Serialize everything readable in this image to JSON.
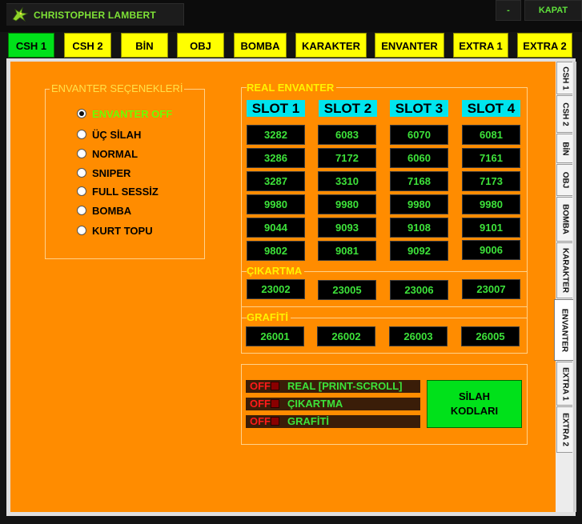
{
  "window": {
    "title": "CHRISTOPHER LAMBERT",
    "minimize_label": "-",
    "close_label": "KAPAT"
  },
  "tabs": [
    {
      "label": "CSH 1",
      "active": true
    },
    {
      "label": "CSH 2",
      "active": false
    },
    {
      "label": "BİN",
      "active": false
    },
    {
      "label": "OBJ",
      "active": false
    },
    {
      "label": "BOMBA",
      "active": false
    },
    {
      "label": "KARAKTER",
      "active": false
    },
    {
      "label": "ENVANTER",
      "active": false
    },
    {
      "label": "EXTRA 1",
      "active": false
    },
    {
      "label": "EXTRA 2",
      "active": false
    }
  ],
  "side_tabs": [
    {
      "label": "CSH 1",
      "active": false
    },
    {
      "label": "CSH 2",
      "active": false
    },
    {
      "label": "BİN",
      "active": false
    },
    {
      "label": "OBJ",
      "active": false
    },
    {
      "label": "BOMBA",
      "active": false
    },
    {
      "label": "KARAKTER",
      "active": false
    },
    {
      "label": "ENVANTER",
      "active": true
    },
    {
      "label": "EXTRA 1",
      "active": false
    },
    {
      "label": "EXTRA 2",
      "active": false
    }
  ],
  "envanter_options": {
    "title": "ENVANTER SEÇENEKLERİ",
    "items": [
      {
        "label": "ENVANTER OFF",
        "selected": true
      },
      {
        "label": "ÜÇ SİLAH",
        "selected": false
      },
      {
        "label": "NORMAL",
        "selected": false
      },
      {
        "label": "SNIPER",
        "selected": false
      },
      {
        "label": "FULL SESSİZ",
        "selected": false
      },
      {
        "label": "BOMBA",
        "selected": false
      },
      {
        "label": "KURT TOPU",
        "selected": false
      }
    ]
  },
  "real_envanter": {
    "title": "REAL ENVANTER",
    "slot_headers": [
      "SLOT 1",
      "SLOT 2",
      "SLOT 3",
      "SLOT 4"
    ],
    "rows": [
      [
        "3282",
        "6083",
        "6070",
        "6081"
      ],
      [
        "3286",
        "7172",
        "6060",
        "7161"
      ],
      [
        "3287",
        "3310",
        "7168",
        "7173"
      ],
      [
        "9980",
        "9980",
        "9980",
        "9980"
      ],
      [
        "9044",
        "9093",
        "9108",
        "9101"
      ],
      [
        "9802",
        "9081",
        "9092",
        "9006"
      ]
    ]
  },
  "cikartma": {
    "title": "ÇIKARTMA",
    "values": [
      "23002",
      "23005",
      "23006",
      "23007"
    ]
  },
  "grafiti": {
    "title": "GRAFİTİ",
    "values": [
      "26001",
      "26002",
      "26003",
      "26005"
    ]
  },
  "toggles": [
    {
      "state": "OFF",
      "label": "REAL  [PRINT-SCROLL]"
    },
    {
      "state": "OFF",
      "label": "ÇIKARTMA"
    },
    {
      "state": "OFF",
      "label": "GRAFİTİ"
    }
  ],
  "silah_button": {
    "line1": "SİLAH",
    "line2": "KODLARI"
  },
  "colors": {
    "panel": "#ff8c00",
    "tab_inactive": "#ffff00",
    "tab_active": "#00e11a",
    "slot_header": "#00e5ee",
    "value_text": "#3de23a",
    "off_text": "#ff1a1a"
  }
}
